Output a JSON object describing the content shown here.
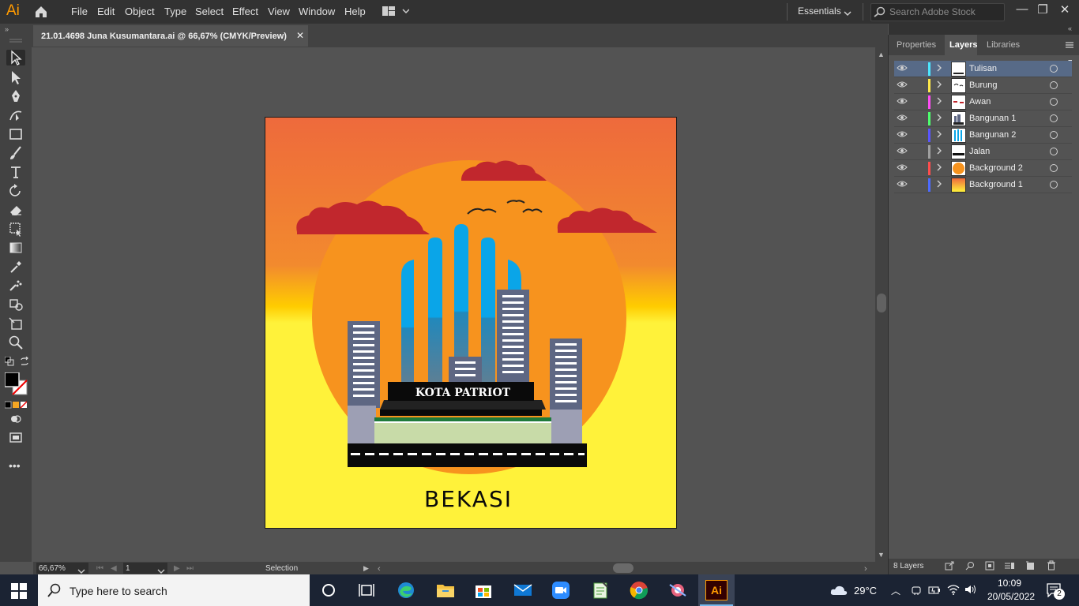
{
  "app": {
    "logo": "Ai",
    "menu": [
      "File",
      "Edit",
      "Object",
      "Type",
      "Select",
      "Effect",
      "View",
      "Window",
      "Help"
    ],
    "workspace": "Essentials",
    "search_placeholder": "Search Adobe Stock",
    "window_controls": {
      "minimize": "—",
      "restore": "❐",
      "close": "✕"
    }
  },
  "document": {
    "tab_title": "21.01.4698 Juna Kusumantara.ai @ 66,67% (CMYK/Preview)",
    "close": "✕"
  },
  "artwork": {
    "building_sign": "KOTA PATRIOT",
    "city_label": "BEKASI",
    "colors": {
      "sky_top": "#ee6a3c",
      "sky_bottom": "#fff23a",
      "sun": "#f7931e",
      "cloud": "#c1272d",
      "tower": "#0aa5e8",
      "building": "#5e6783",
      "road": "#0a0a0a"
    }
  },
  "statusbar": {
    "zoom": "66,67%",
    "artboard_num": "1",
    "tool": "Selection"
  },
  "panel": {
    "tabs": [
      "Properties",
      "Layers",
      "Libraries"
    ],
    "active_tab": "Layers",
    "layers": [
      {
        "name": "Tulisan",
        "color": "#4de7ff",
        "selected": true
      },
      {
        "name": "Burung",
        "color": "#ffe94a",
        "selected": false
      },
      {
        "name": "Awan",
        "color": "#ff4df5",
        "selected": false
      },
      {
        "name": "Bangunan 1",
        "color": "#4dff6e",
        "selected": false
      },
      {
        "name": "Bangunan 2",
        "color": "#5a55ff",
        "selected": false
      },
      {
        "name": "Jalan",
        "color": "#a0a0a0",
        "selected": false
      },
      {
        "name": "Background 2",
        "color": "#ff4d4d",
        "selected": false
      },
      {
        "name": "Background 1",
        "color": "#4d6bff",
        "selected": false
      }
    ],
    "layer_count": "8 Layers"
  },
  "taskbar": {
    "search_placeholder": "Type here to search",
    "weather": "29°C",
    "time": "10:09",
    "date": "20/05/2022",
    "notifications": "2"
  }
}
